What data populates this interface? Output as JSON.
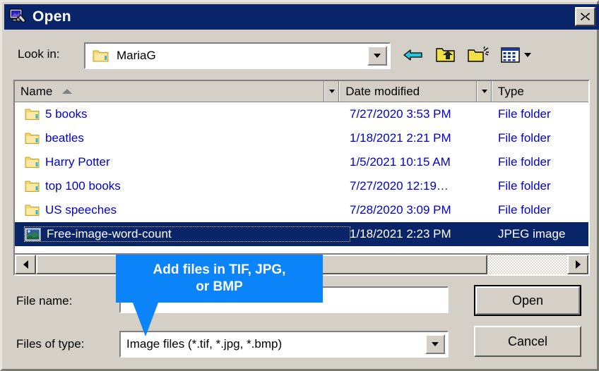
{
  "window": {
    "title": "Open",
    "title_icon": "computer-open-icon",
    "close_label": "✕"
  },
  "toolbar": {
    "lookin_label": "Look in:",
    "lookin_value": "MariaG",
    "lookin_folder_icon": "folder-icon",
    "lookin_dropdown_icon": "chevron-down-icon",
    "back_icon": "back-arrow-icon",
    "up_icon": "up-one-level-icon",
    "newfolder_icon": "new-folder-icon",
    "views_icon": "views-icon",
    "views_dropdown_icon": "chevron-down-icon"
  },
  "listview": {
    "columns": [
      "Name",
      "Date modified",
      "Type"
    ],
    "sort_column": "Name",
    "sort_direction": "ascending",
    "rows": [
      {
        "name": "5 books",
        "date": "7/27/2020 3:53 PM",
        "type": "File folder",
        "icon": "folder-icon",
        "selected": false
      },
      {
        "name": "beatles",
        "date": "1/18/2021 2:21 PM",
        "type": "File folder",
        "icon": "folder-icon",
        "selected": false
      },
      {
        "name": "Harry Potter",
        "date": "1/5/2021 10:15 AM",
        "type": "File folder",
        "icon": "folder-icon",
        "selected": false
      },
      {
        "name": "top 100 books",
        "date": "7/27/2020 12:19…",
        "type": "File folder",
        "icon": "folder-icon",
        "selected": false
      },
      {
        "name": "US speeches",
        "date": "7/28/2020 3:09 PM",
        "type": "File folder",
        "icon": "folder-icon",
        "selected": false
      },
      {
        "name": "Free-image-word-count",
        "date": "1/18/2021 2:23 PM",
        "type": "JPEG image",
        "icon": "image-thumbnail-icon",
        "selected": true
      }
    ]
  },
  "scrollbar": {
    "left_icon": "scroll-left-icon",
    "right_icon": "scroll-right-icon",
    "thumb_fraction": 85
  },
  "fields": {
    "filename_label": "File name:",
    "filename_value": "",
    "filename_placeholder": "",
    "filestype_label": "Files of type:",
    "filestype_value": "Image files (*.tif, *.jpg, *.bmp)",
    "filestype_dropdown_icon": "chevron-down-icon"
  },
  "buttons": {
    "open": "Open",
    "cancel": "Cancel"
  },
  "callout": {
    "line1": "Add files in TIF, JPG,",
    "line2": "or BMP",
    "color": "#0b84fa",
    "text_color": "#ffffff"
  },
  "colors": {
    "titlebar": "#0a246a",
    "dialog_bg": "#d4d0c8",
    "selection": "#0a246a",
    "link_text": "#0000d0",
    "callout": "#0b84fa"
  }
}
